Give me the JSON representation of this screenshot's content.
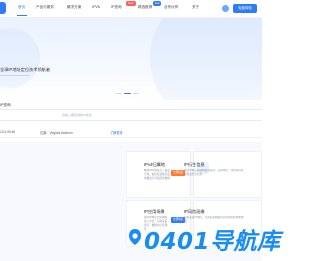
{
  "nav": {
    "items": [
      {
        "label": "首页"
      },
      {
        "label": "产品与服务"
      },
      {
        "label": "解决方案"
      },
      {
        "label": "IPV6"
      },
      {
        "label": "IP查询"
      },
      {
        "label": "精选推荐"
      },
      {
        "label": "合作伙伴"
      },
      {
        "label": "关于"
      }
    ],
    "badges": [
      "New",
      "Hot"
    ],
    "login_label": "免费体验"
  },
  "hero": {
    "title": "全球IP地址定位技术领航者",
    "slides": 3,
    "active_slide": 1
  },
  "search": {
    "label": "IP查询",
    "hint": "请输入要查询的IP地址"
  },
  "ip_info": {
    "ip": "13.4.99.46",
    "location_label": "位置：Virginia Ashburn",
    "link_label": "了解更多"
  },
  "products": [
    {
      "title": "IPv4归属地",
      "desc": "精准IPv4地址库，覆盖全球，提供街道级别定位精度与行政区划数据",
      "button": "立即购买",
      "icon": "location-pin-icon",
      "color": "#2f7df6"
    },
    {
      "title": "IP衍生信息",
      "desc": "通过IP地址获取网络运营商、应用场景、风险评估等多维度衍生信息",
      "button": "",
      "icon": "network-icon",
      "color": "#2f7df6"
    },
    {
      "title": "IP应用场景",
      "desc": "通过IP地址分析网络接入方式，识别家庭宽带、数据中心等场景",
      "button": "立即购买",
      "icon": "scene-icon",
      "color": "#2f7df6"
    },
    {
      "title": "IP风险画像",
      "desc": "识别恶意IP地址，为风控系统提供实时的风险判断依据",
      "button": "",
      "icon": "shield-icon",
      "color": "#2f7df6"
    }
  ],
  "watermark": {
    "text": "0401导航库"
  },
  "colors": {
    "accent": "#2f7df6",
    "orange": "#ff7a2f",
    "watermark": "#1a8df5"
  }
}
